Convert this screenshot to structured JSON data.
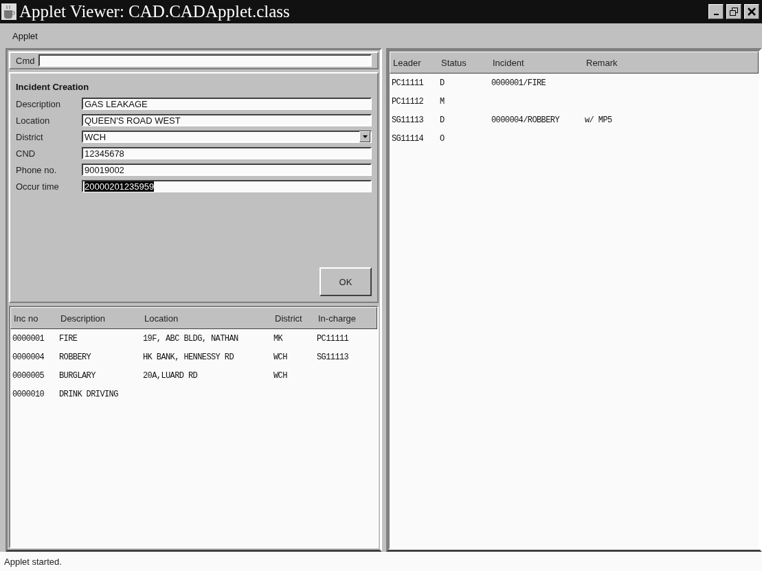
{
  "window": {
    "title": "Applet Viewer: CAD.CADApplet.class"
  },
  "menu": [
    "Applet"
  ],
  "cmd": {
    "label": "Cmd"
  },
  "form": {
    "title": "Incident Creation",
    "fields": [
      {
        "label": "Description",
        "kind": "text",
        "value": "GAS LEAKAGE",
        "selected": false
      },
      {
        "label": "Location",
        "kind": "text",
        "value": "QUEEN'S ROAD WEST",
        "selected": false
      },
      {
        "label": "District",
        "kind": "dropdown",
        "value": "WCH",
        "selected": false
      },
      {
        "label": "CND",
        "kind": "text",
        "value": "12345678",
        "selected": false
      },
      {
        "label": "Phone no.",
        "kind": "text",
        "value": "90019002",
        "selected": false
      },
      {
        "label": "Occur time",
        "kind": "text",
        "value": "20000201235959",
        "selected": true
      }
    ],
    "button": "OK"
  },
  "incidents": {
    "columns": [
      "Inc no",
      "Description",
      "Location",
      "District",
      "In-charge"
    ],
    "rows": [
      [
        "0000001",
        "FIRE",
        "19F, ABC BLDG, NATHAN",
        "MK",
        "PC11111"
      ],
      [
        "0000004",
        "ROBBERY",
        "HK BANK, HENNESSY RD",
        "WCH",
        "SG11113"
      ],
      [
        "0000005",
        "BURGLARY",
        "20A,LUARD RD",
        "WCH",
        ""
      ],
      [
        "0000010",
        "DRINK DRIVING",
        "",
        "",
        ""
      ]
    ]
  },
  "units": {
    "columns": [
      "Leader",
      "Status",
      "Incident",
      "Remark"
    ],
    "rows": [
      [
        "PC11111",
        "D",
        "0000001/FIRE",
        ""
      ],
      [
        "PC11112",
        "M",
        "",
        ""
      ],
      [
        "SG11113",
        "D",
        "0000004/ROBBERY",
        "w/ MP5"
      ],
      [
        "SG11114",
        "O",
        "",
        ""
      ]
    ]
  },
  "status_bar": "Applet started."
}
